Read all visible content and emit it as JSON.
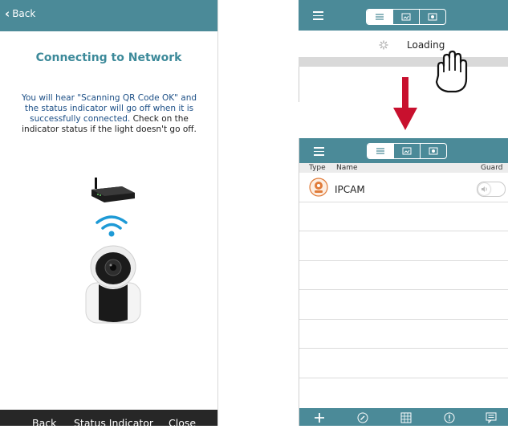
{
  "left": {
    "nav": {
      "back_label": "Back"
    },
    "title": "Connecting to Network",
    "message": {
      "highlight": "You will hear \"Scanning QR Code OK\" and the status indicator will go off when it is successfully connected.",
      "normal": " Check on the indicator status if the light doesn't go off."
    },
    "bottom": {
      "back": "Back",
      "status": "Status Indicator",
      "close": "Close"
    }
  },
  "right_top": {
    "loading_text": "Loading"
  },
  "right_bottom": {
    "columns": {
      "type": "Type",
      "name": "Name",
      "guard": "Guard"
    },
    "devices": [
      {
        "name": "IPCAM",
        "guard": "off"
      }
    ]
  },
  "colors": {
    "header": "#4b8a98",
    "title": "#3d8a9a",
    "arrow": "#c8102e",
    "bottom_bar": "#272727"
  }
}
